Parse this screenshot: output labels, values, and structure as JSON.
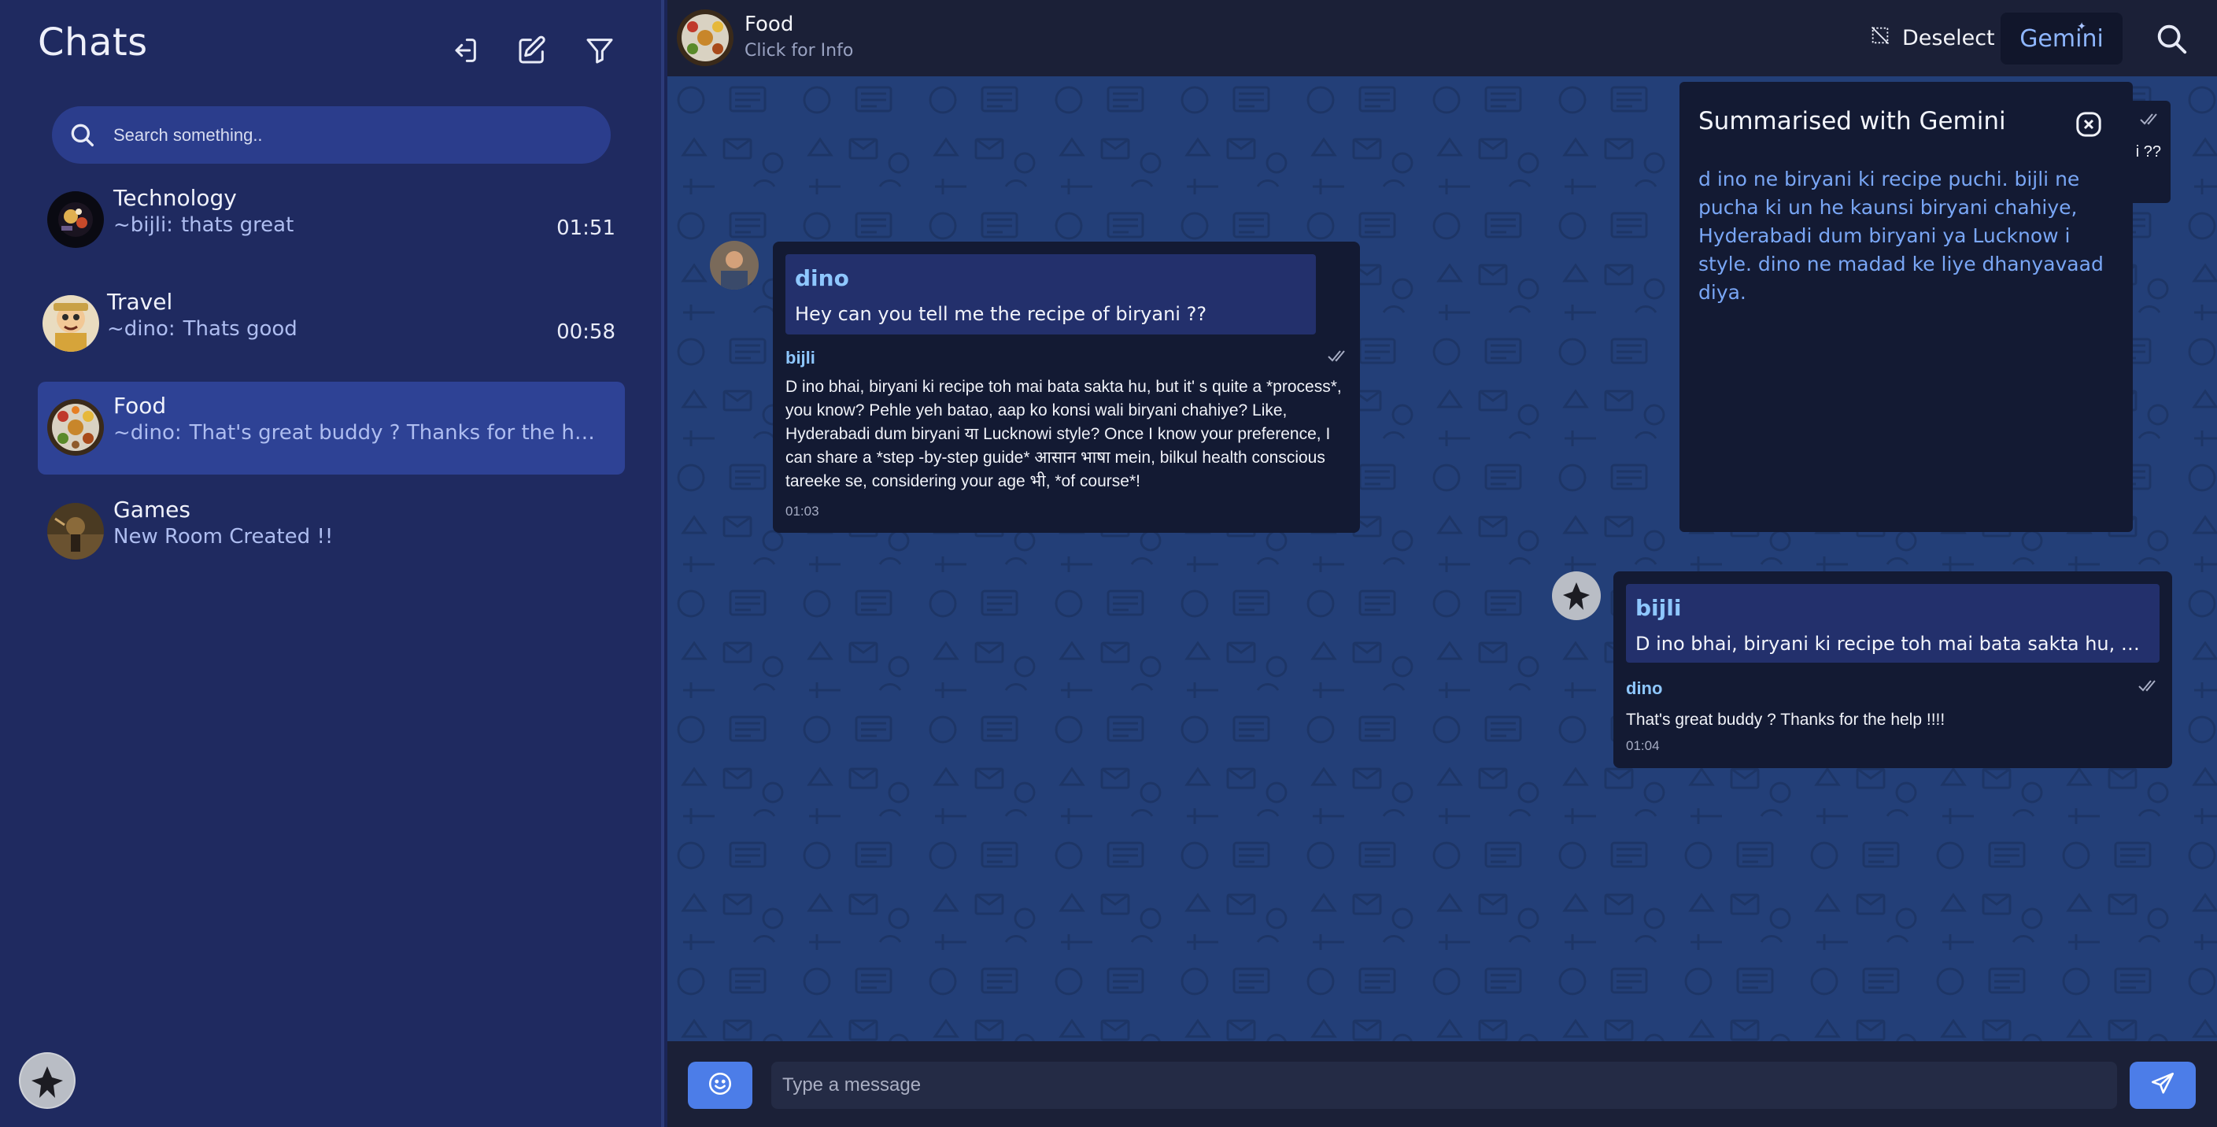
{
  "sidebar": {
    "title": "Chats",
    "icons": {
      "logout": "logout-icon",
      "edit": "edit-icon",
      "filter": "filter-icon"
    },
    "search": {
      "placeholder": "Search something.."
    },
    "chats": [
      {
        "name": "Technology",
        "sender": "~bijli:",
        "preview": "thats great",
        "time": "01:51"
      },
      {
        "name": "Travel",
        "sender": "~dino:",
        "preview": "Thats good",
        "time": "00:58"
      },
      {
        "name": "Food",
        "sender": "~dino:",
        "preview": "That's great buddy ? Thanks for the help !!!!",
        "time": "01:04"
      },
      {
        "name": "Games",
        "sender": "",
        "preview": "New Room Created !!",
        "time": ""
      }
    ]
  },
  "header": {
    "name": "Food",
    "subtitle": "Click for Info",
    "deselect_label": "Deselect",
    "gemini_label": "Gemini"
  },
  "messages": [
    {
      "reply_name": "dino",
      "reply_text": "Hey can you tell me the recipe of biryani ??",
      "sender": "bijli",
      "text": "D ino bhai, biryani ki recipe toh mai bata sakta hu, but it' s quite a *process*, you know? Pehle yeh batao, aap ko konsi wali biryani chahiye? Like, Hyderabadi dum biryani या Lucknowi style? Once I know your preference, I can share a *step -by-step guide* आसान भाषा mein, bilkul health conscious tareeke se, considering your age भी, *of course*!",
      "time": "01:03"
    },
    {
      "reply_name": "bijli",
      "reply_text": "D ino bhai, biryani ki recipe toh mai bata sakta hu, but it' s quite a *process*, you know?",
      "sender": "dino",
      "text": "That's great buddy ? Thanks for the help !!!!",
      "time": "01:04"
    }
  ],
  "peek_text": "i ??",
  "summary": {
    "title": "Summarised with Gemini",
    "body": "d ino ne biryani ki recipe puchi. bijli ne pucha ki un he kaunsi biryani chahiye, Hyderabadi dum biryani ya Lucknow i style. dino ne madad ke liye dhanyavaad diya."
  },
  "footer": {
    "placeholder": "Type a message"
  },
  "colors": {
    "accent": "#4c7de8",
    "sidebar_bg": "#1f2a60",
    "active_item": "#2e4295",
    "chat_bg": "#233f78",
    "bubble": "#131a33",
    "sender_name": "#8ec7ff",
    "summary_text": "#79a6f5"
  }
}
